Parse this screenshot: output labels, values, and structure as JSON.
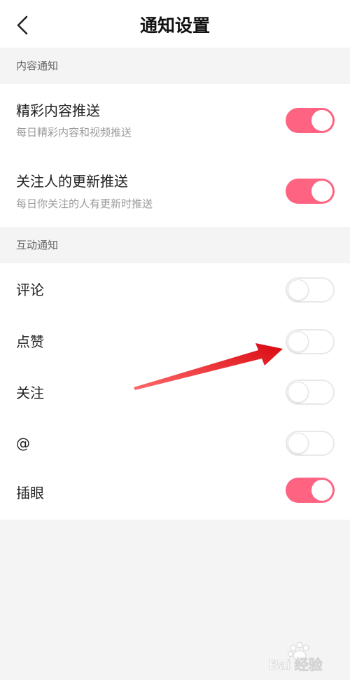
{
  "header": {
    "title": "通知设置",
    "back_icon": "chevron-left-icon"
  },
  "colors": {
    "accent": "#fe6381",
    "page_background": "#f4f4f4",
    "card_background": "#ffffff",
    "annotation_arrow": "#e8101a"
  },
  "sections": [
    {
      "header": "内容通知",
      "items": [
        {
          "title": "精彩内容推送",
          "subtitle": "每日精彩内容和视频推送",
          "enabled": true
        },
        {
          "title": "关注人的更新推送",
          "subtitle": "每日你关注的人有更新时推送",
          "enabled": true
        }
      ]
    },
    {
      "header": "互动通知",
      "items": [
        {
          "title": "评论",
          "enabled": false
        },
        {
          "title": "点赞",
          "enabled": false
        },
        {
          "title": "关注",
          "enabled": false
        },
        {
          "title": "@",
          "enabled": false
        },
        {
          "title": "插眼",
          "enabled": true
        }
      ]
    }
  ],
  "annotation": {
    "type": "arrow",
    "points_to": "点赞"
  },
  "watermark": {
    "text": "Bai 经验"
  }
}
